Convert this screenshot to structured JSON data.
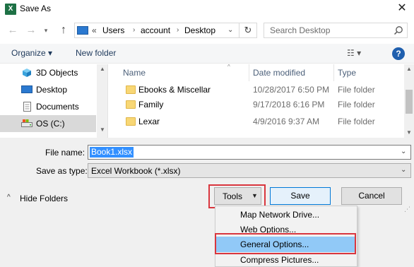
{
  "window": {
    "title": "Save As",
    "app_icon_letter": "X",
    "close_glyph": "✕"
  },
  "nav": {
    "back_glyph": "←",
    "forward_glyph": "→",
    "recent_glyph": "▾",
    "up_glyph": "↑",
    "address": {
      "chevron": "«",
      "crumbs": [
        "Users",
        "account",
        "Desktop"
      ],
      "separator": "›",
      "dropdown_glyph": "⌄",
      "refresh_glyph": "↻"
    },
    "search_placeholder": "Search Desktop"
  },
  "toolbar": {
    "organize_label": "Organize ▾",
    "new_folder_label": "New folder",
    "view_label": "☷ ▾",
    "help_label": "?"
  },
  "nav_pane": {
    "items": [
      {
        "label": "3D Objects",
        "icon": "cube-icon"
      },
      {
        "label": "Desktop",
        "icon": "desktop-icon"
      },
      {
        "label": "Documents",
        "icon": "document-icon"
      },
      {
        "label": "OS (C:)",
        "icon": "drive-icon"
      }
    ],
    "selected_index": 3
  },
  "file_list": {
    "columns": [
      "Name",
      "Date modified",
      "Type"
    ],
    "sort_glyph": "^",
    "rows": [
      {
        "name": "Ebooks & Miscellar",
        "date": "10/28/2017 6:50 PM",
        "type": "File folder"
      },
      {
        "name": "Family",
        "date": "9/17/2018 6:16 PM",
        "type": "File folder"
      },
      {
        "name": "Lexar",
        "date": "4/9/2016 9:37 AM",
        "type": "File folder"
      }
    ]
  },
  "form": {
    "file_name_label": "File name:",
    "file_name_value": "Book1.xlsx",
    "save_type_label": "Save as type:",
    "save_type_value": "Excel Workbook (*.xlsx)",
    "dropdown_glyph": "⌄"
  },
  "buttons": {
    "hide_folders_arrow": "^",
    "hide_folders_label": "Hide Folders",
    "tools_label": "Tools",
    "tools_dropdown_glyph": "▼",
    "save_label": "Save",
    "cancel_label": "Cancel"
  },
  "tools_menu": {
    "items": [
      "Map Network Drive...",
      "Web Options...",
      "General Options...",
      "Compress Pictures..."
    ],
    "highlighted_index": 2
  },
  "colors": {
    "highlight_border": "#d9363e",
    "menu_highlight": "#91c9f7",
    "selection": "#3390ff",
    "excel_green": "#1e7145"
  }
}
